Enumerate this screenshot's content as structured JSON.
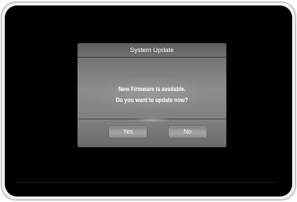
{
  "dialog": {
    "title": "System Update",
    "message_line1": "New Firmware is available.",
    "message_line2": "Do you want to update now?",
    "buttons": {
      "yes": "Yes",
      "no": "No"
    }
  },
  "colors": {
    "screen_background": "#000000",
    "dialog_background": "#808080",
    "text": "#ffffff"
  }
}
